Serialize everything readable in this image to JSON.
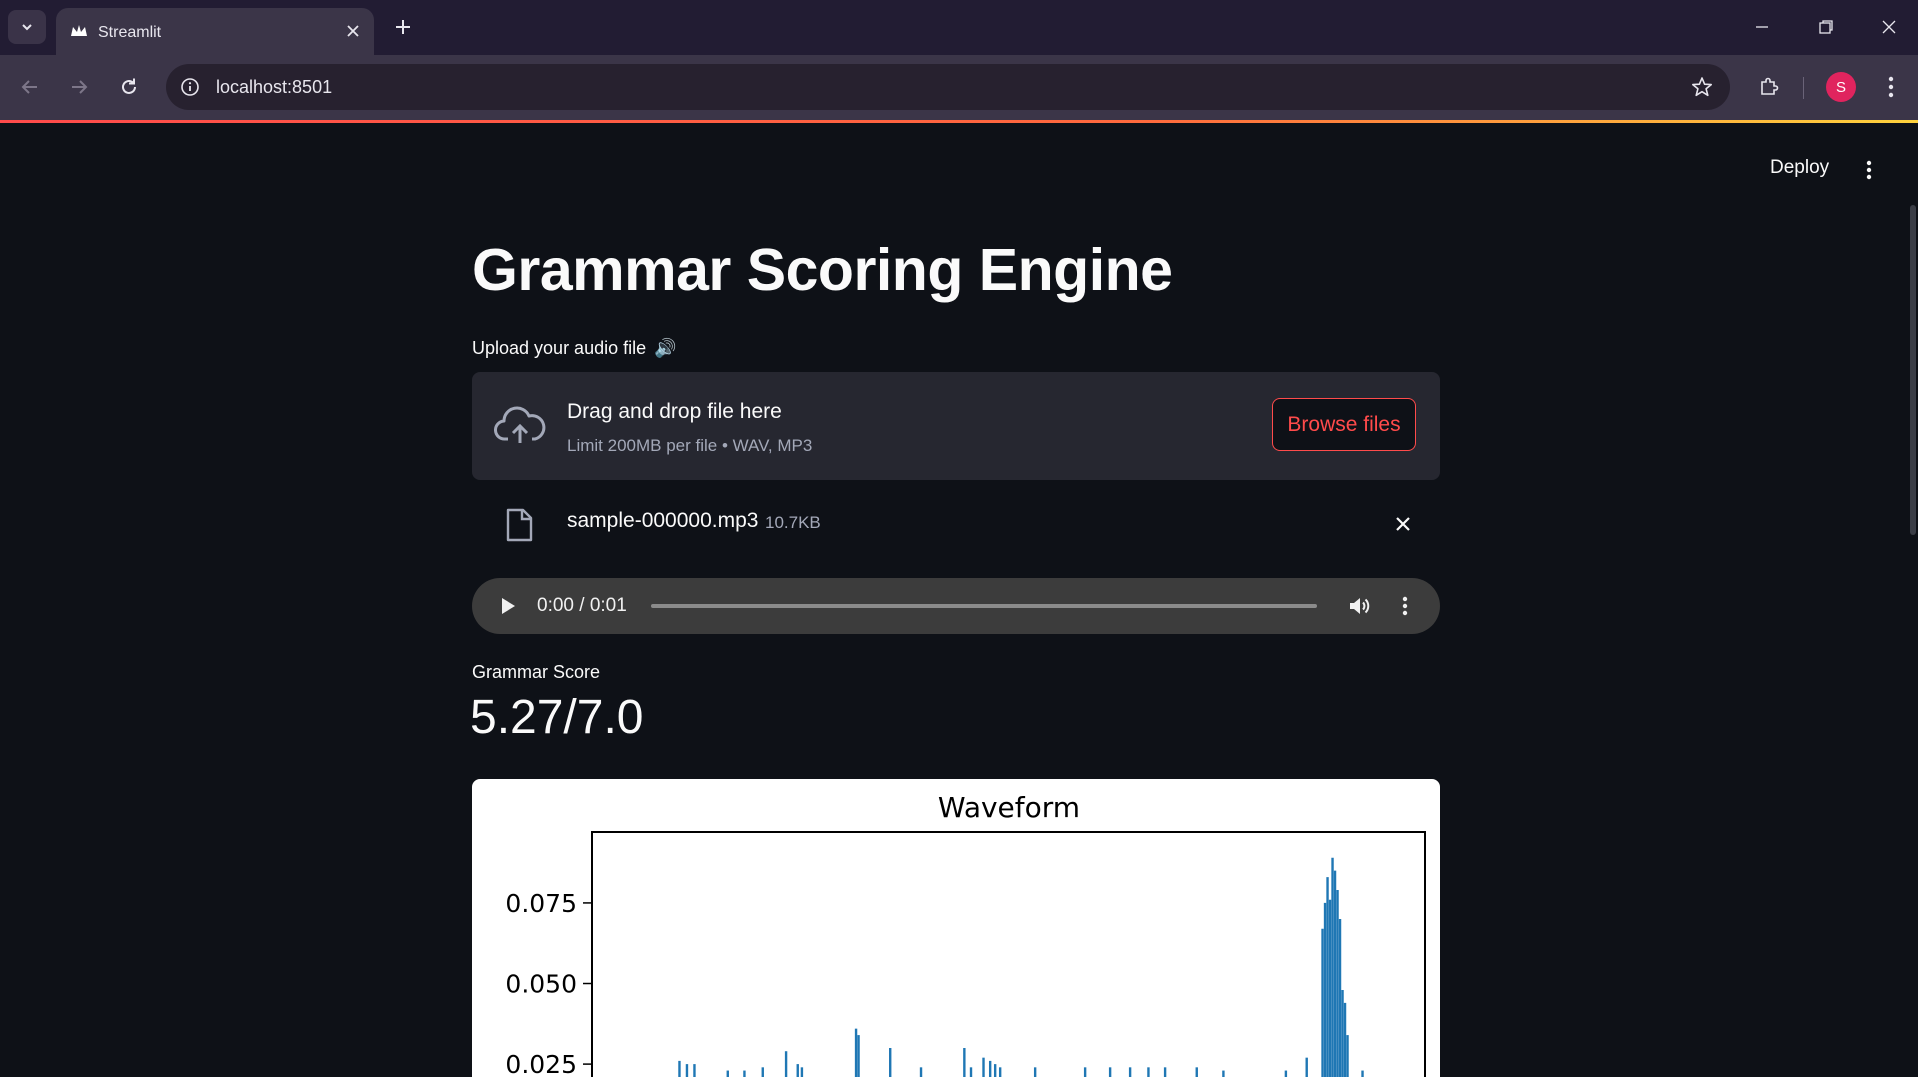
{
  "browser": {
    "tab_title": "Streamlit",
    "url": "localhost:8501",
    "profile_initial": "S"
  },
  "app": {
    "deploy_label": "Deploy",
    "title": "Grammar Scoring Engine",
    "upload": {
      "label": "Upload your audio file",
      "label_icon": "🔊",
      "drop_text": "Drag and drop file here",
      "limit_text": "Limit 200MB per file • WAV, MP3",
      "browse_label": "Browse files"
    },
    "file": {
      "name": "sample-000000.mp3",
      "size": "10.7KB"
    },
    "audio_player": {
      "time": "0:00 / 0:01",
      "progress": 0
    },
    "metric": {
      "label": "Grammar Score",
      "value": "5.27/7.0"
    }
  },
  "colors": {
    "accent": "#ff4b4b",
    "background": "#0e1117",
    "series": "#1f77b4"
  },
  "chart_data": {
    "type": "line",
    "title": "Waveform",
    "xlabel": "",
    "ylabel": "",
    "ytick_labels": [
      "0.025",
      "0.050",
      "0.075"
    ],
    "yticks": [
      0.025,
      0.05,
      0.075
    ],
    "ylim_visible": [
      0.021,
      0.097
    ],
    "x_domain": [
      0,
      1
    ],
    "grid": false,
    "spikes": [
      {
        "x": 0.105,
        "y": 0.026
      },
      {
        "x": 0.114,
        "y": 0.025
      },
      {
        "x": 0.123,
        "y": 0.025
      },
      {
        "x": 0.163,
        "y": 0.023
      },
      {
        "x": 0.183,
        "y": 0.023
      },
      {
        "x": 0.205,
        "y": 0.024
      },
      {
        "x": 0.233,
        "y": 0.029
      },
      {
        "x": 0.247,
        "y": 0.025
      },
      {
        "x": 0.252,
        "y": 0.024
      },
      {
        "x": 0.317,
        "y": 0.036
      },
      {
        "x": 0.32,
        "y": 0.034
      },
      {
        "x": 0.358,
        "y": 0.03
      },
      {
        "x": 0.395,
        "y": 0.024
      },
      {
        "x": 0.447,
        "y": 0.03
      },
      {
        "x": 0.455,
        "y": 0.024
      },
      {
        "x": 0.47,
        "y": 0.027
      },
      {
        "x": 0.478,
        "y": 0.026
      },
      {
        "x": 0.484,
        "y": 0.025
      },
      {
        "x": 0.49,
        "y": 0.024
      },
      {
        "x": 0.532,
        "y": 0.024
      },
      {
        "x": 0.592,
        "y": 0.024
      },
      {
        "x": 0.622,
        "y": 0.024
      },
      {
        "x": 0.646,
        "y": 0.024
      },
      {
        "x": 0.668,
        "y": 0.024
      },
      {
        "x": 0.688,
        "y": 0.024
      },
      {
        "x": 0.726,
        "y": 0.024
      },
      {
        "x": 0.758,
        "y": 0.023
      },
      {
        "x": 0.833,
        "y": 0.023
      },
      {
        "x": 0.858,
        "y": 0.027
      },
      {
        "x": 0.877,
        "y": 0.067
      },
      {
        "x": 0.88,
        "y": 0.075
      },
      {
        "x": 0.883,
        "y": 0.083
      },
      {
        "x": 0.886,
        "y": 0.076
      },
      {
        "x": 0.889,
        "y": 0.089
      },
      {
        "x": 0.892,
        "y": 0.085
      },
      {
        "x": 0.895,
        "y": 0.079
      },
      {
        "x": 0.898,
        "y": 0.07
      },
      {
        "x": 0.901,
        "y": 0.048
      },
      {
        "x": 0.904,
        "y": 0.044
      },
      {
        "x": 0.907,
        "y": 0.034
      },
      {
        "x": 0.925,
        "y": 0.023
      }
    ]
  }
}
